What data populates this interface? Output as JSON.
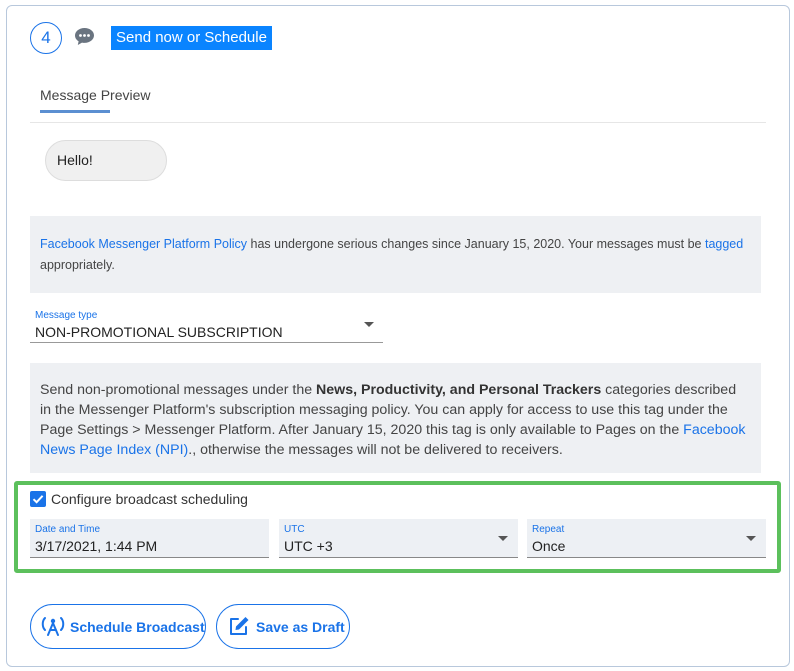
{
  "step": {
    "number": "4",
    "title": "Send now or Schedule"
  },
  "tabs": {
    "preview_label": "Message Preview"
  },
  "preview": {
    "message": "Hello!"
  },
  "notice": {
    "link1": "Facebook Messenger Platform Policy",
    "text1": " has undergone serious changes since January 15, 2020. Your messages must be ",
    "link2": "tagged",
    "text2": " appropriately."
  },
  "message_type": {
    "label": "Message type",
    "value": "NON-PROMOTIONAL SUBSCRIPTION"
  },
  "description": {
    "text1": "Send non-promotional messages under the ",
    "bold": "News, Productivity, and Personal Trackers",
    "text2": " categories described in the Messenger Platform's subscription messaging policy. You can apply for access to use this tag under the Page Settings > Messenger Platform. After January 15, 2020 this tag is only available to Pages on the ",
    "link": "Facebook News Page Index (NPI)",
    "text3": "., otherwise the messages will not be delivered to receivers."
  },
  "scheduling": {
    "checkbox_label": "Configure broadcast scheduling",
    "checked": true,
    "date_label": "Date and Time",
    "date_value": "3/17/2021, 1:44 PM",
    "tz_label": "UTC",
    "tz_value": "UTC +3",
    "repeat_label": "Repeat",
    "repeat_value": "Once"
  },
  "actions": {
    "schedule_label": "Schedule Broadcast",
    "draft_label": "Save as Draft"
  },
  "colors": {
    "accent": "#1a73e8",
    "highlight_border": "#5cc05c",
    "title_bg": "#0a84ff"
  },
  "icons": {
    "step_icon": "chat-bubble-icon",
    "schedule_icon": "broadcast-antenna-icon",
    "draft_icon": "edit-pencil-icon"
  }
}
